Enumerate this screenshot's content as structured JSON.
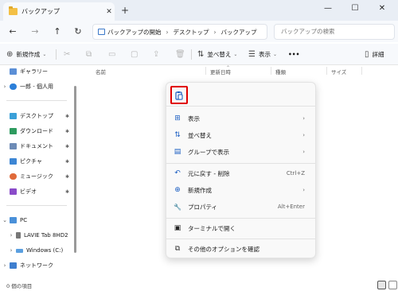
{
  "window": {
    "tab_title": "バックアップ",
    "tab_close": "✕",
    "new_tab": "+",
    "minimize": "—",
    "maximize": "☐",
    "close": "✕"
  },
  "nav": {
    "back": "←",
    "forward": "→",
    "up": "↑",
    "refresh": "↻",
    "breadcrumb": [
      "バックアップの開始",
      "デスクトップ",
      "バックアップ"
    ],
    "breadcrumb_sep": "›",
    "search_placeholder": "バックアップの検索"
  },
  "toolbar": {
    "new_label": "新規作成",
    "sort_label": "並べ替え",
    "view_label": "表示",
    "more_label": "•••",
    "details_label": "詳細"
  },
  "sidebar": {
    "items": [
      {
        "label": "ギャラリー",
        "chevron": "",
        "icon": "gallery-icon",
        "pin": ""
      },
      {
        "label": "一郎 - 個人用",
        "chevron": "›",
        "icon": "cloud-icon",
        "pin": ""
      },
      {
        "label": "デスクトップ",
        "chevron": "",
        "icon": "desktop-icon",
        "pin": "✱"
      },
      {
        "label": "ダウンロード",
        "chevron": "",
        "icon": "downloads-icon",
        "pin": "✱"
      },
      {
        "label": "ドキュメント",
        "chevron": "",
        "icon": "documents-icon",
        "pin": "✱"
      },
      {
        "label": "ピクチャ",
        "chevron": "",
        "icon": "pictures-icon",
        "pin": "✱"
      },
      {
        "label": "ミュージック",
        "chevron": "",
        "icon": "music-icon",
        "pin": "✱"
      },
      {
        "label": "ビデオ",
        "chevron": "",
        "icon": "videos-icon",
        "pin": "✱"
      },
      {
        "label": "PC",
        "chevron": "⌄",
        "icon": "pc-icon",
        "pin": ""
      },
      {
        "label": "LAVIE Tab 8HD2",
        "chevron": "›",
        "icon": "tablet-icon",
        "pin": ""
      },
      {
        "label": "Windows (C:)",
        "chevron": "›",
        "icon": "drive-icon",
        "pin": ""
      },
      {
        "label": "ネットワーク",
        "chevron": "›",
        "icon": "network-icon",
        "pin": ""
      }
    ]
  },
  "columns": [
    "名前",
    "更新日時",
    "種類",
    "サイズ"
  ],
  "context_menu": {
    "items": [
      {
        "label": "表示",
        "icon": "grid-icon",
        "glyph": "⊞",
        "right": "›"
      },
      {
        "label": "並べ替え",
        "icon": "sort-icon",
        "glyph": "⇅",
        "right": "›"
      },
      {
        "label": "グループで表示",
        "icon": "group-icon",
        "glyph": "▤",
        "right": "›"
      },
      {
        "label": "元に戻す - 削除",
        "icon": "undo-icon",
        "glyph": "↶",
        "right": "Ctrl+Z"
      },
      {
        "label": "新規作成",
        "icon": "new-icon",
        "glyph": "⊕",
        "right": "›"
      },
      {
        "label": "プロパティ",
        "icon": "properties-icon",
        "glyph": "🔧",
        "right": "Alt+Enter"
      },
      {
        "label": "ターミナルで開く",
        "icon": "terminal-icon",
        "glyph": "▣",
        "right": ""
      },
      {
        "label": "その他のオプションを確認",
        "icon": "more-options-icon",
        "glyph": "⧉",
        "right": ""
      }
    ]
  },
  "status": {
    "item_count": "0 個の項目"
  },
  "colors": {
    "accent": "#1c5fc2",
    "highlight": "#e00000",
    "folder": "#f3c046"
  }
}
